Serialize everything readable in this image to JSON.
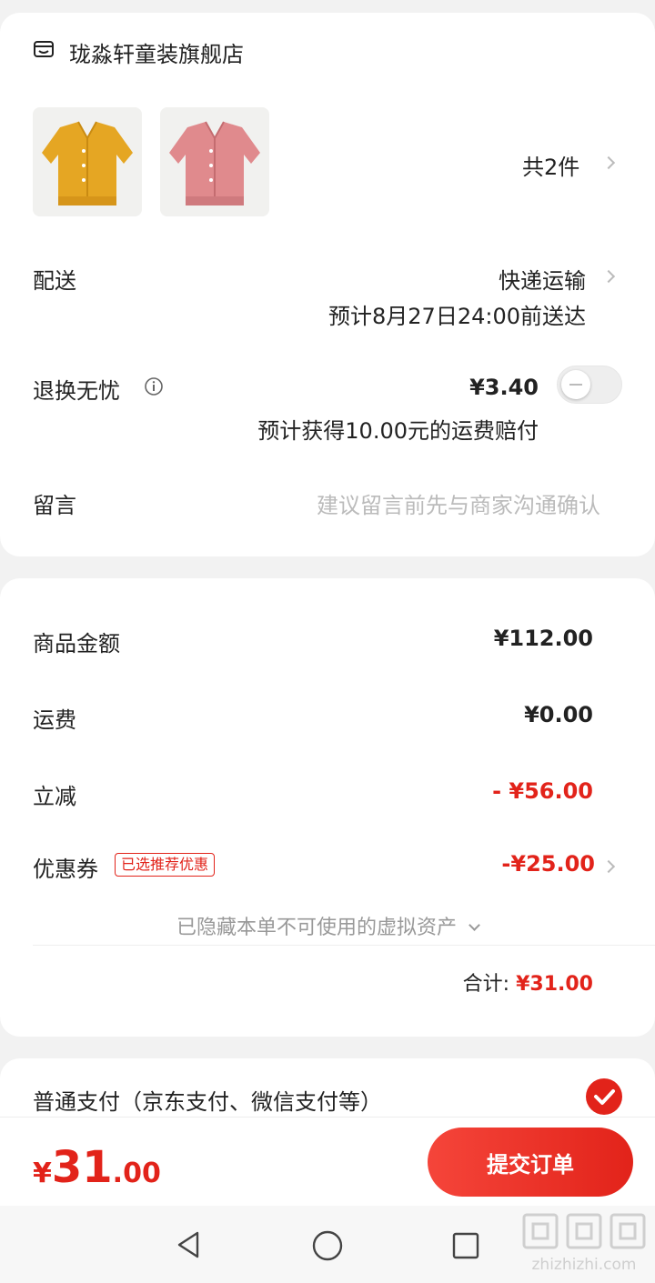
{
  "store": {
    "name": "珑淼轩童装旗舰店",
    "icon": "store-icon",
    "product_count": "共2件",
    "products": [
      {
        "color": "#e5a623",
        "icon": "yellow-cardigan-image"
      },
      {
        "color": "#e08a8d",
        "icon": "pink-cardigan-image"
      }
    ]
  },
  "delivery": {
    "label": "配送",
    "method": "快递运输",
    "eta": "预计8月27日24:00前送达"
  },
  "return_insurance": {
    "label": "退换无忧",
    "info_icon": "info-icon",
    "price": "¥3.40",
    "note": "预计获得10.00元的运费赔付",
    "enabled": false
  },
  "message": {
    "label": "留言",
    "placeholder": "建议留言前先与商家沟通确认"
  },
  "summary": {
    "goods_label": "商品金额",
    "goods_value": "¥112.00",
    "shipping_label": "运费",
    "shipping_value": "¥0.00",
    "discount_label": "立减",
    "discount_value": "- ¥56.00",
    "coupon_label": "优惠券",
    "coupon_badge": "已选推荐优惠",
    "coupon_value": "-¥25.00",
    "hidden_assets": "已隐藏本单不可使用的虚拟资产",
    "total_label": "合计:",
    "total_value": "¥31.00"
  },
  "payment": {
    "label": "普通支付（京东支付、微信支付等）",
    "selected": true
  },
  "footer": {
    "currency": "¥",
    "amount_int": "31",
    "amount_dec": ".00",
    "submit_label": "提交订单"
  },
  "watermark": "zhizhizhi.com",
  "colors": {
    "accent": "#e2231a",
    "background": "#f2f2f2"
  }
}
